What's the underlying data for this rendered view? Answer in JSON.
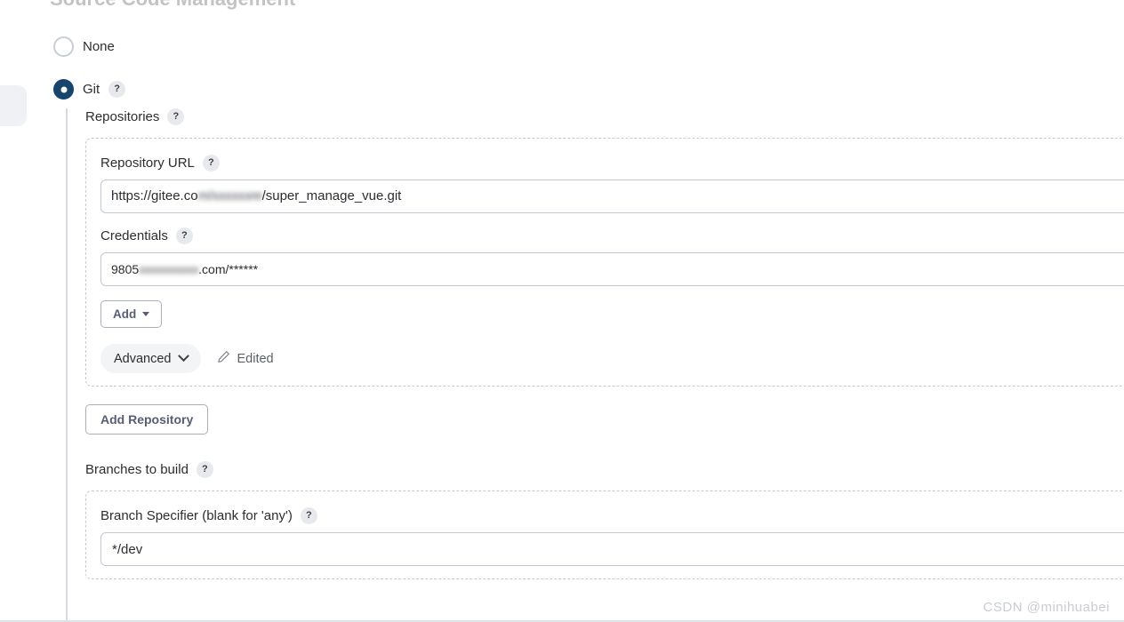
{
  "page": {
    "cutoff_heading": "Source Code Management",
    "watermark": "CSDN @minihuabei"
  },
  "scm": {
    "options": [
      {
        "label": "None",
        "selected": false
      },
      {
        "label": "Git",
        "selected": true,
        "help": "?"
      }
    ]
  },
  "git": {
    "repositories_label": "Repositories",
    "repositories_help": "?",
    "repository": {
      "url_label": "Repository URL",
      "url_help": "?",
      "url_value": "https://gitee.com/xxxxxre/super_manage_vue.git",
      "url_prefix": "https://gitee.co",
      "url_masked": "m/xxxxxxre",
      "url_suffix": "/super_manage_vue.git",
      "credentials_label": "Credentials",
      "credentials_help": "?",
      "credentials_value": "9805xxxxxxxx.com/******",
      "credentials_prefix": "9805",
      "credentials_masked": "xxxxxxxxxx",
      "credentials_suffix": ".com/******",
      "add_label": "Add",
      "advanced_label": "Advanced",
      "edited_label": "Edited"
    },
    "add_repository_label": "Add Repository",
    "branches_label": "Branches to build",
    "branches_help": "?",
    "branch": {
      "specifier_label": "Branch Specifier (blank for 'any')",
      "specifier_help": "?",
      "specifier_value": "*/dev",
      "specifier_placeholder": ""
    }
  },
  "colors": {
    "accent": "#15456c",
    "border": "#c3c9d2",
    "button_text": "#575e73",
    "muted": "#5b5f66"
  }
}
